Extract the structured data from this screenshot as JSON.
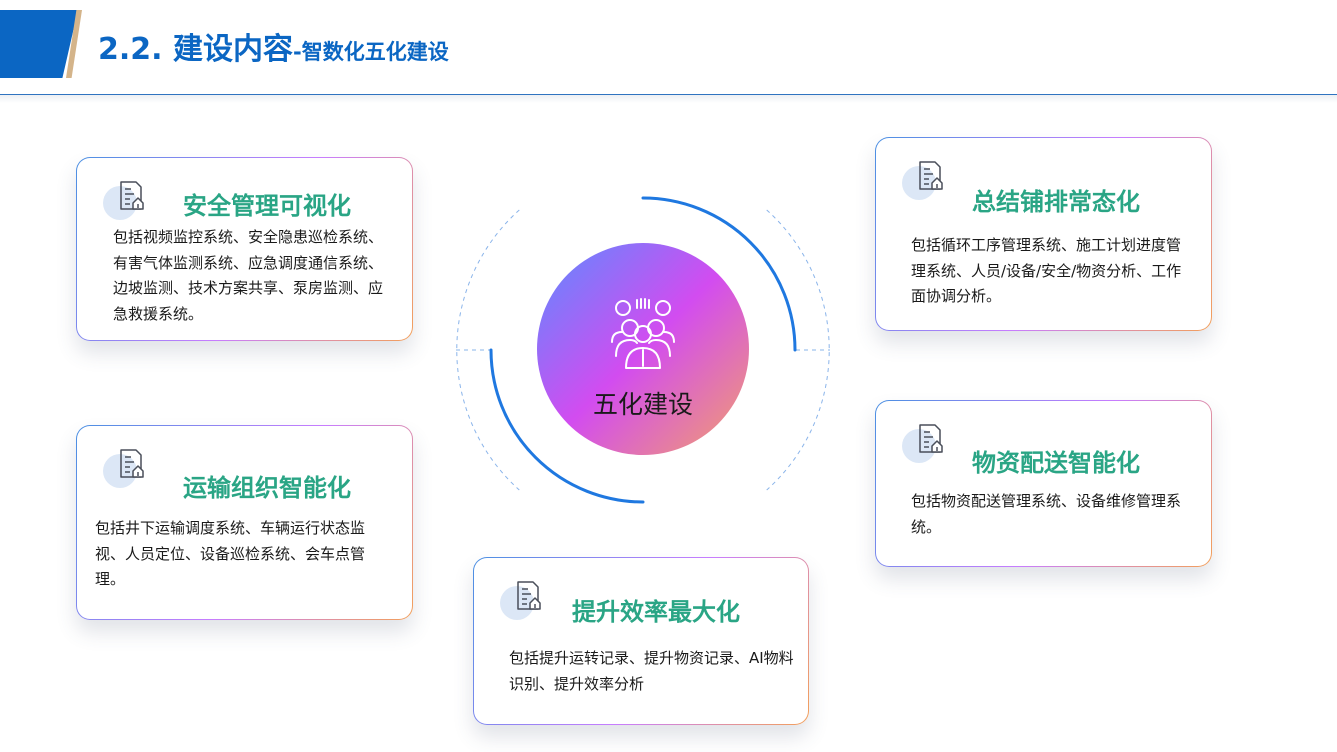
{
  "header": {
    "title_main": "2.2. 建设内容",
    "title_sub": "-智数化五化建设"
  },
  "center": {
    "label": "五化建设",
    "icon": "team-icon"
  },
  "cards": [
    {
      "id": "safety",
      "title": "安全管理可视化",
      "icon": "document-icon",
      "description": "包括视频监控系统、安全隐患巡检系统、有害气体监测系统、应急调度通信系统、边坡监测、技术方案共享、泵房监测、应急救援系统。"
    },
    {
      "id": "summary",
      "title": "总结铺排常态化",
      "icon": "document-icon",
      "description": "包括循环工序管理系统、施工计划进度管理系统、人员/设备/安全/物资分析、工作面协调分析。"
    },
    {
      "id": "transport",
      "title": "运输组织智能化",
      "icon": "document-icon",
      "description": "包括井下运输调度系统、车辆运行状态监视、人员定位、设备巡检系统、会车点管理。"
    },
    {
      "id": "material",
      "title": "物资配送智能化",
      "icon": "document-icon",
      "description": "包括物资配送管理系统、设备维修管理系统。"
    },
    {
      "id": "hoist",
      "title": "提升效率最大化",
      "icon": "document-icon",
      "description": "包括提升运转记录、提升物资记录、AI物料识别、提升效率分析"
    }
  ],
  "colors": {
    "brand_blue": "#0b66c3",
    "accent_gold": "#d4b48a",
    "title_green": "#2aa585",
    "ring_blue": "#1f78e0"
  }
}
